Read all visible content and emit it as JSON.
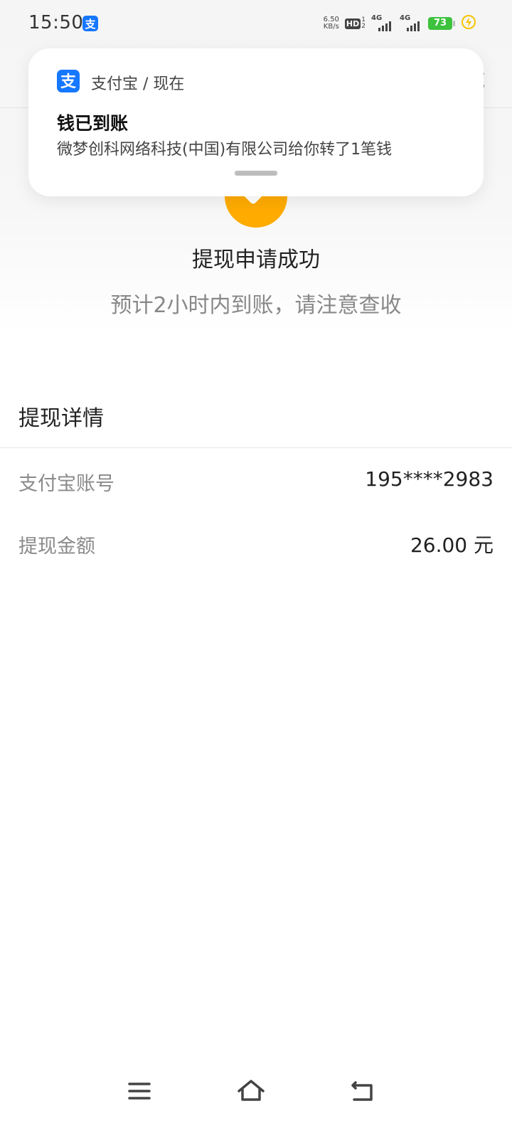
{
  "status_bar": {
    "time": "15:50",
    "net_speed_value": "6.50",
    "net_speed_unit": "KB/s",
    "hd_label": "HD",
    "hd_sim_1": "1",
    "hd_sim_2": "2",
    "sim1_network": "4G",
    "sim2_network": "4G",
    "battery": "73",
    "battery_color": "#3cc23c",
    "charging_icon": "lightning-icon"
  },
  "nav": {
    "right_text_partial": "成"
  },
  "notification": {
    "app_name": "支付宝 / 现在",
    "title": "钱已到账",
    "body": "微梦创科网络科技(中国)有限公司给你转了1笔钱",
    "app_icon": "alipay-icon",
    "brand_color": "#1677ff"
  },
  "result": {
    "icon": "check-circle-icon",
    "icon_color": "#ffab00",
    "title": "提现申请成功",
    "subtitle": "预计2小时内到账，请注意查收"
  },
  "details": {
    "header": "提现详情",
    "rows": [
      {
        "label": "支付宝账号",
        "value": "195****2983"
      },
      {
        "label": "提现金额",
        "value": "26.00 元"
      }
    ]
  },
  "system_nav": {
    "buttons": [
      "menu-icon",
      "home-icon",
      "back-icon"
    ]
  }
}
